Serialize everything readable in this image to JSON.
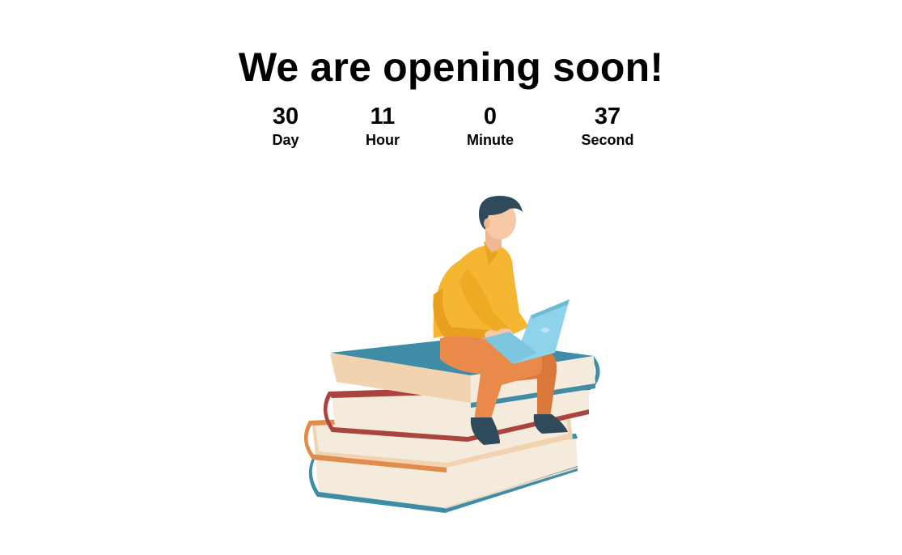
{
  "page": {
    "title": "We are opening soon!"
  },
  "countdown": {
    "day": {
      "value": "30",
      "label": "Day"
    },
    "hour": {
      "value": "11",
      "label": "Hour"
    },
    "minute": {
      "value": "0",
      "label": "Minute"
    },
    "second": {
      "value": "37",
      "label": "Second"
    }
  },
  "illustration": {
    "name": "person-reading-on-books-illustration",
    "colors": {
      "shirt": "#F5B731",
      "pants": "#E98A4A",
      "skin": "#F7C9A6",
      "hair": "#2F4A5A",
      "laptop": "#8FD3EA",
      "book_teal": "#3F8CA6",
      "book_red": "#A9453E",
      "book_orange": "#E38B4D",
      "pages": "#F4EBDD",
      "pages_warm": "#F1D3B0"
    }
  }
}
